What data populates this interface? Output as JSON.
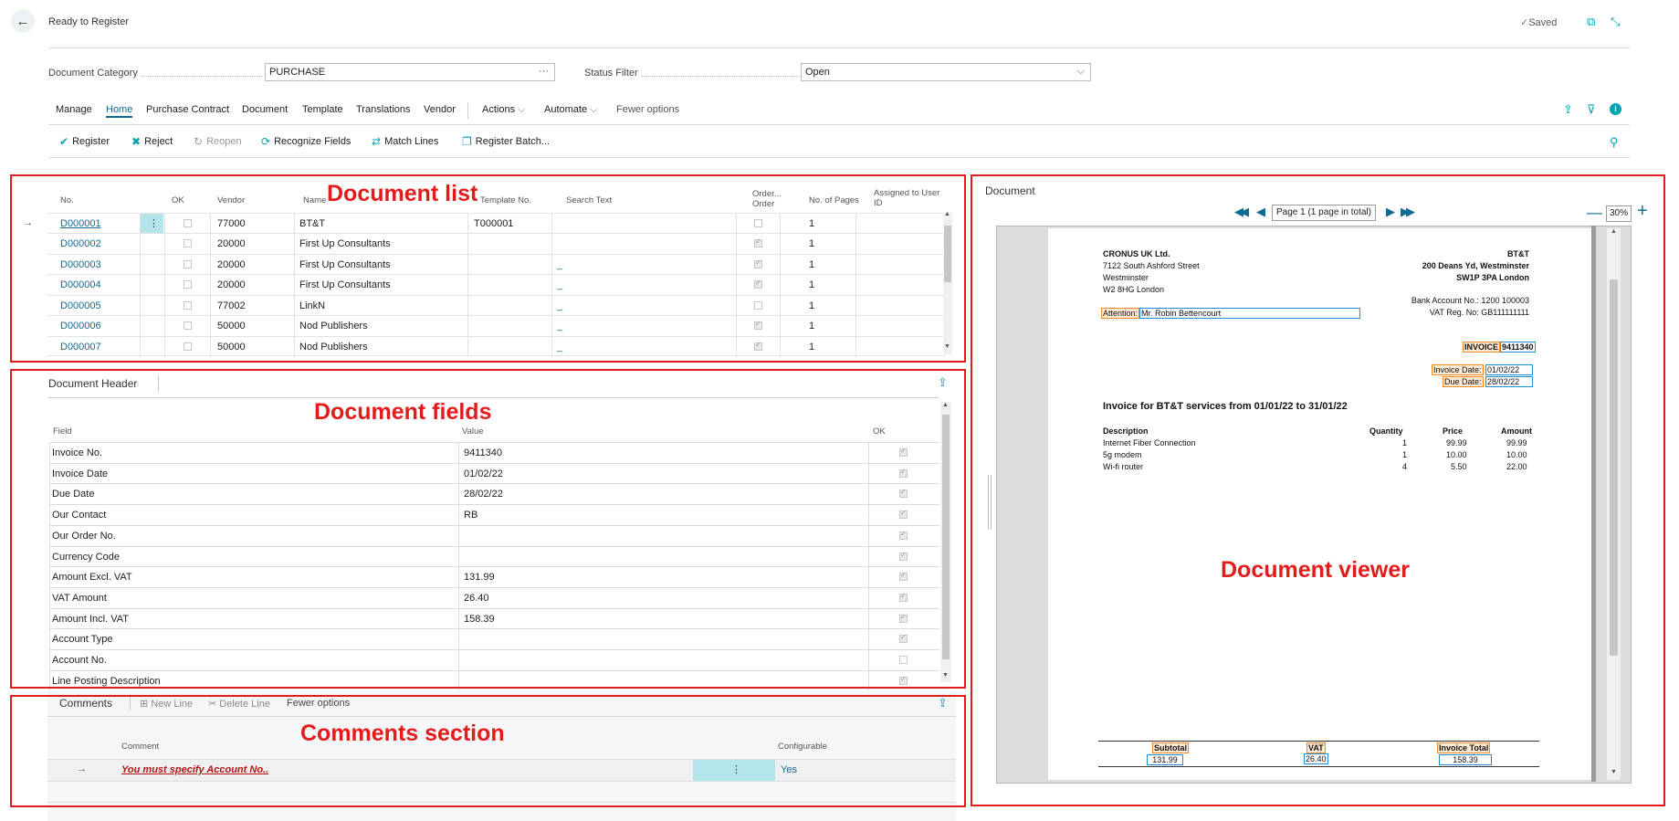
{
  "window": {
    "title": "Ready to Register",
    "saved_label": "Saved"
  },
  "filters": {
    "category_label": "Document Category",
    "category_value": "PURCHASE",
    "status_label": "Status Filter",
    "status_value": "Open"
  },
  "menu": [
    "Manage",
    "Home",
    "Purchase Contract",
    "Document",
    "Template",
    "Translations",
    "Vendor",
    "Actions",
    "Automate",
    "Fewer options"
  ],
  "actions": {
    "register": "Register",
    "reject": "Reject",
    "reopen": "Reopen",
    "recognize": "Recognize Fields",
    "match": "Match Lines",
    "batch": "Register Batch..."
  },
  "annotations": {
    "list": "Document list",
    "fields": "Document fields",
    "comments": "Comments section",
    "viewer": "Document viewer"
  },
  "doc_list": {
    "headers": {
      "no": "No.",
      "ok": "OK",
      "vendor": "Vendor",
      "name": "Name",
      "template": "Template No.",
      "search": "Search Text",
      "order1": "Order...",
      "order2": "Order",
      "pages": "No. of Pages",
      "assigned1": "Assigned to User",
      "assigned2": "ID"
    },
    "rows": [
      {
        "no": "D000001",
        "vendor": "77000",
        "name": "BT&T",
        "template": "T000001",
        "search": "",
        "ok": false,
        "order": false,
        "pages": "1"
      },
      {
        "no": "D000002",
        "vendor": "20000",
        "name": "First Up Consultants",
        "template": "",
        "search": "",
        "ok": false,
        "order": true,
        "pages": "1"
      },
      {
        "no": "D000003",
        "vendor": "20000",
        "name": "First Up Consultants",
        "template": "",
        "search": "_",
        "ok": false,
        "order": true,
        "pages": "1"
      },
      {
        "no": "D000004",
        "vendor": "20000",
        "name": "First Up Consultants",
        "template": "",
        "search": "_",
        "ok": false,
        "order": true,
        "pages": "1"
      },
      {
        "no": "D000005",
        "vendor": "77002",
        "name": "LinkN",
        "template": "",
        "search": "_",
        "ok": false,
        "order": false,
        "pages": "1"
      },
      {
        "no": "D000006",
        "vendor": "50000",
        "name": "Nod Publishers",
        "template": "",
        "search": "_",
        "ok": false,
        "order": true,
        "pages": "1"
      },
      {
        "no": "D000007",
        "vendor": "50000",
        "name": "Nod Publishers",
        "template": "",
        "search": "_",
        "ok": false,
        "order": true,
        "pages": "1"
      }
    ]
  },
  "doc_header": {
    "title": "Document Header",
    "col_field": "Field",
    "col_value": "Value",
    "col_ok": "OK",
    "rows": [
      {
        "field": "Invoice No.",
        "value": "9411340",
        "ok": true
      },
      {
        "field": "Invoice Date",
        "value": "01/02/22",
        "ok": true
      },
      {
        "field": "Due Date",
        "value": "28/02/22",
        "ok": true
      },
      {
        "field": "Our Contact",
        "value": "RB",
        "ok": true
      },
      {
        "field": "Our Order No.",
        "value": "",
        "ok": true
      },
      {
        "field": "Currency Code",
        "value": "",
        "ok": true
      },
      {
        "field": "Amount Excl. VAT",
        "value": "131.99",
        "ok": true
      },
      {
        "field": "VAT Amount",
        "value": "26.40",
        "ok": true
      },
      {
        "field": "Amount Incl. VAT",
        "value": "158.39",
        "ok": true
      },
      {
        "field": "Account Type",
        "value": "",
        "ok": true
      },
      {
        "field": "Account No.",
        "value": "",
        "ok": false
      },
      {
        "field": "Line Posting Description",
        "value": "",
        "ok": true
      }
    ]
  },
  "comments": {
    "title": "Comments",
    "new_line": "New Line",
    "delete_line": "Delete Line",
    "fewer": "Fewer options",
    "col_comment": "Comment",
    "col_configurable": "Configurable",
    "row_comment": "You must specify Account No..",
    "row_configurable": "Yes"
  },
  "viewer": {
    "title": "Document",
    "page_label": "Page 1 (1 page in total)",
    "zoom": "30%"
  },
  "invoice": {
    "from_name": "CRONUS UK Ltd.",
    "from_addr1": "7122 South Ashford Street",
    "from_addr2": "Westminster",
    "from_addr3": "W2 8HG London",
    "to_name": "BT&T",
    "to_addr1": "200 Deans Yd, Westminster",
    "to_addr2": "SW1P 3PA London",
    "bank": "Bank Account No.: 1200 100003",
    "vat_reg": "VAT Reg. No: GB111111111",
    "attention_label": "Attention:",
    "attention_value": "Mr. Robin Bettencourt",
    "invoice_label": "INVOICE",
    "invoice_no": "9411340",
    "inv_date_label": "Invoice Date:",
    "inv_date": "01/02/22",
    "due_date_label": "Due Date:",
    "due_date": "28/02/22",
    "heading": "Invoice for BT&T services from 01/01/22 to 31/01/22",
    "col_desc": "Description",
    "col_qty": "Quantity",
    "col_price": "Price",
    "col_amount": "Amount",
    "lines": [
      {
        "desc": "Internet Fiber Connection",
        "qty": "1",
        "price": "99.99",
        "amount": "99.99"
      },
      {
        "desc": "5g modem",
        "qty": "1",
        "price": "10.00",
        "amount": "10.00"
      },
      {
        "desc": "Wi-fi router",
        "qty": "4",
        "price": "5.50",
        "amount": "22.00"
      }
    ],
    "subtotal_label": "Subtotal",
    "subtotal": "131.99",
    "vat_label": "VAT",
    "vat": "26.40",
    "total_label": "Invoice Total",
    "total": "158.39"
  }
}
